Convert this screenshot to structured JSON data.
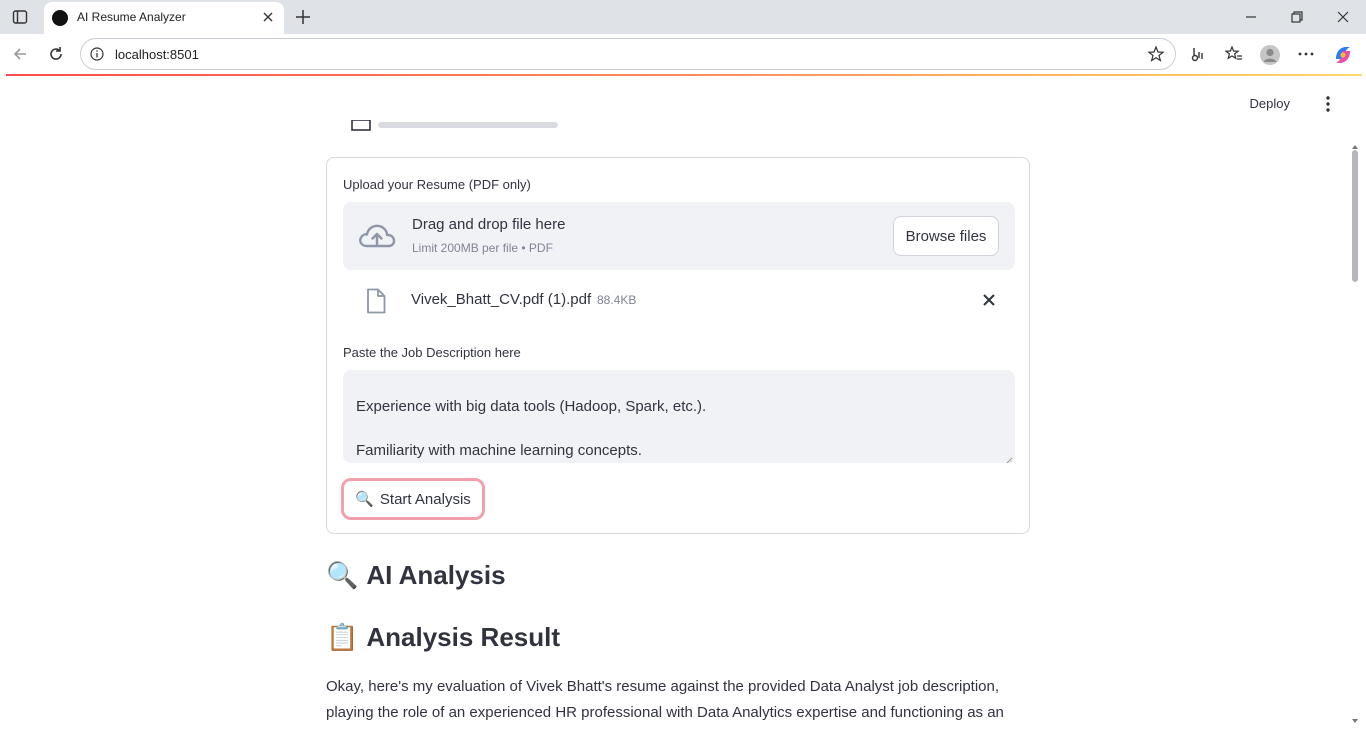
{
  "browser": {
    "tab_title": "AI Resume Analyzer",
    "url": "localhost:8501"
  },
  "header": {
    "deploy_label": "Deploy"
  },
  "form": {
    "upload_label": "Upload your Resume (PDF only)",
    "dropzone_title": "Drag and drop file here",
    "dropzone_limit": "Limit 200MB per file • PDF",
    "browse_label": "Browse files",
    "uploaded_file": {
      "name": "Vivek_Bhatt_CV.pdf (1).pdf",
      "size": "88.4KB"
    },
    "jd_label": "Paste the Job Description here",
    "jd_lines": [
      "Experience with big data tools (Hadoop, Spark, etc.).",
      "Familiarity with machine learning concepts."
    ],
    "start_label": "Start Analysis",
    "start_icon": "🔍"
  },
  "main": {
    "ai_heading": "AI Analysis",
    "ai_icon": "🔍",
    "result_heading": "Analysis Result",
    "result_icon": "📋",
    "result_text": "Okay, here's my evaluation of Vivek Bhatt's resume against the provided Data Analyst job description, playing the role of an experienced HR professional with Data Analytics expertise and functioning as an"
  },
  "colors": {
    "accent_border": "#f3a0ae",
    "loadbar_start": "#ff4b4b",
    "loadbar_end": "#ffd86b"
  }
}
